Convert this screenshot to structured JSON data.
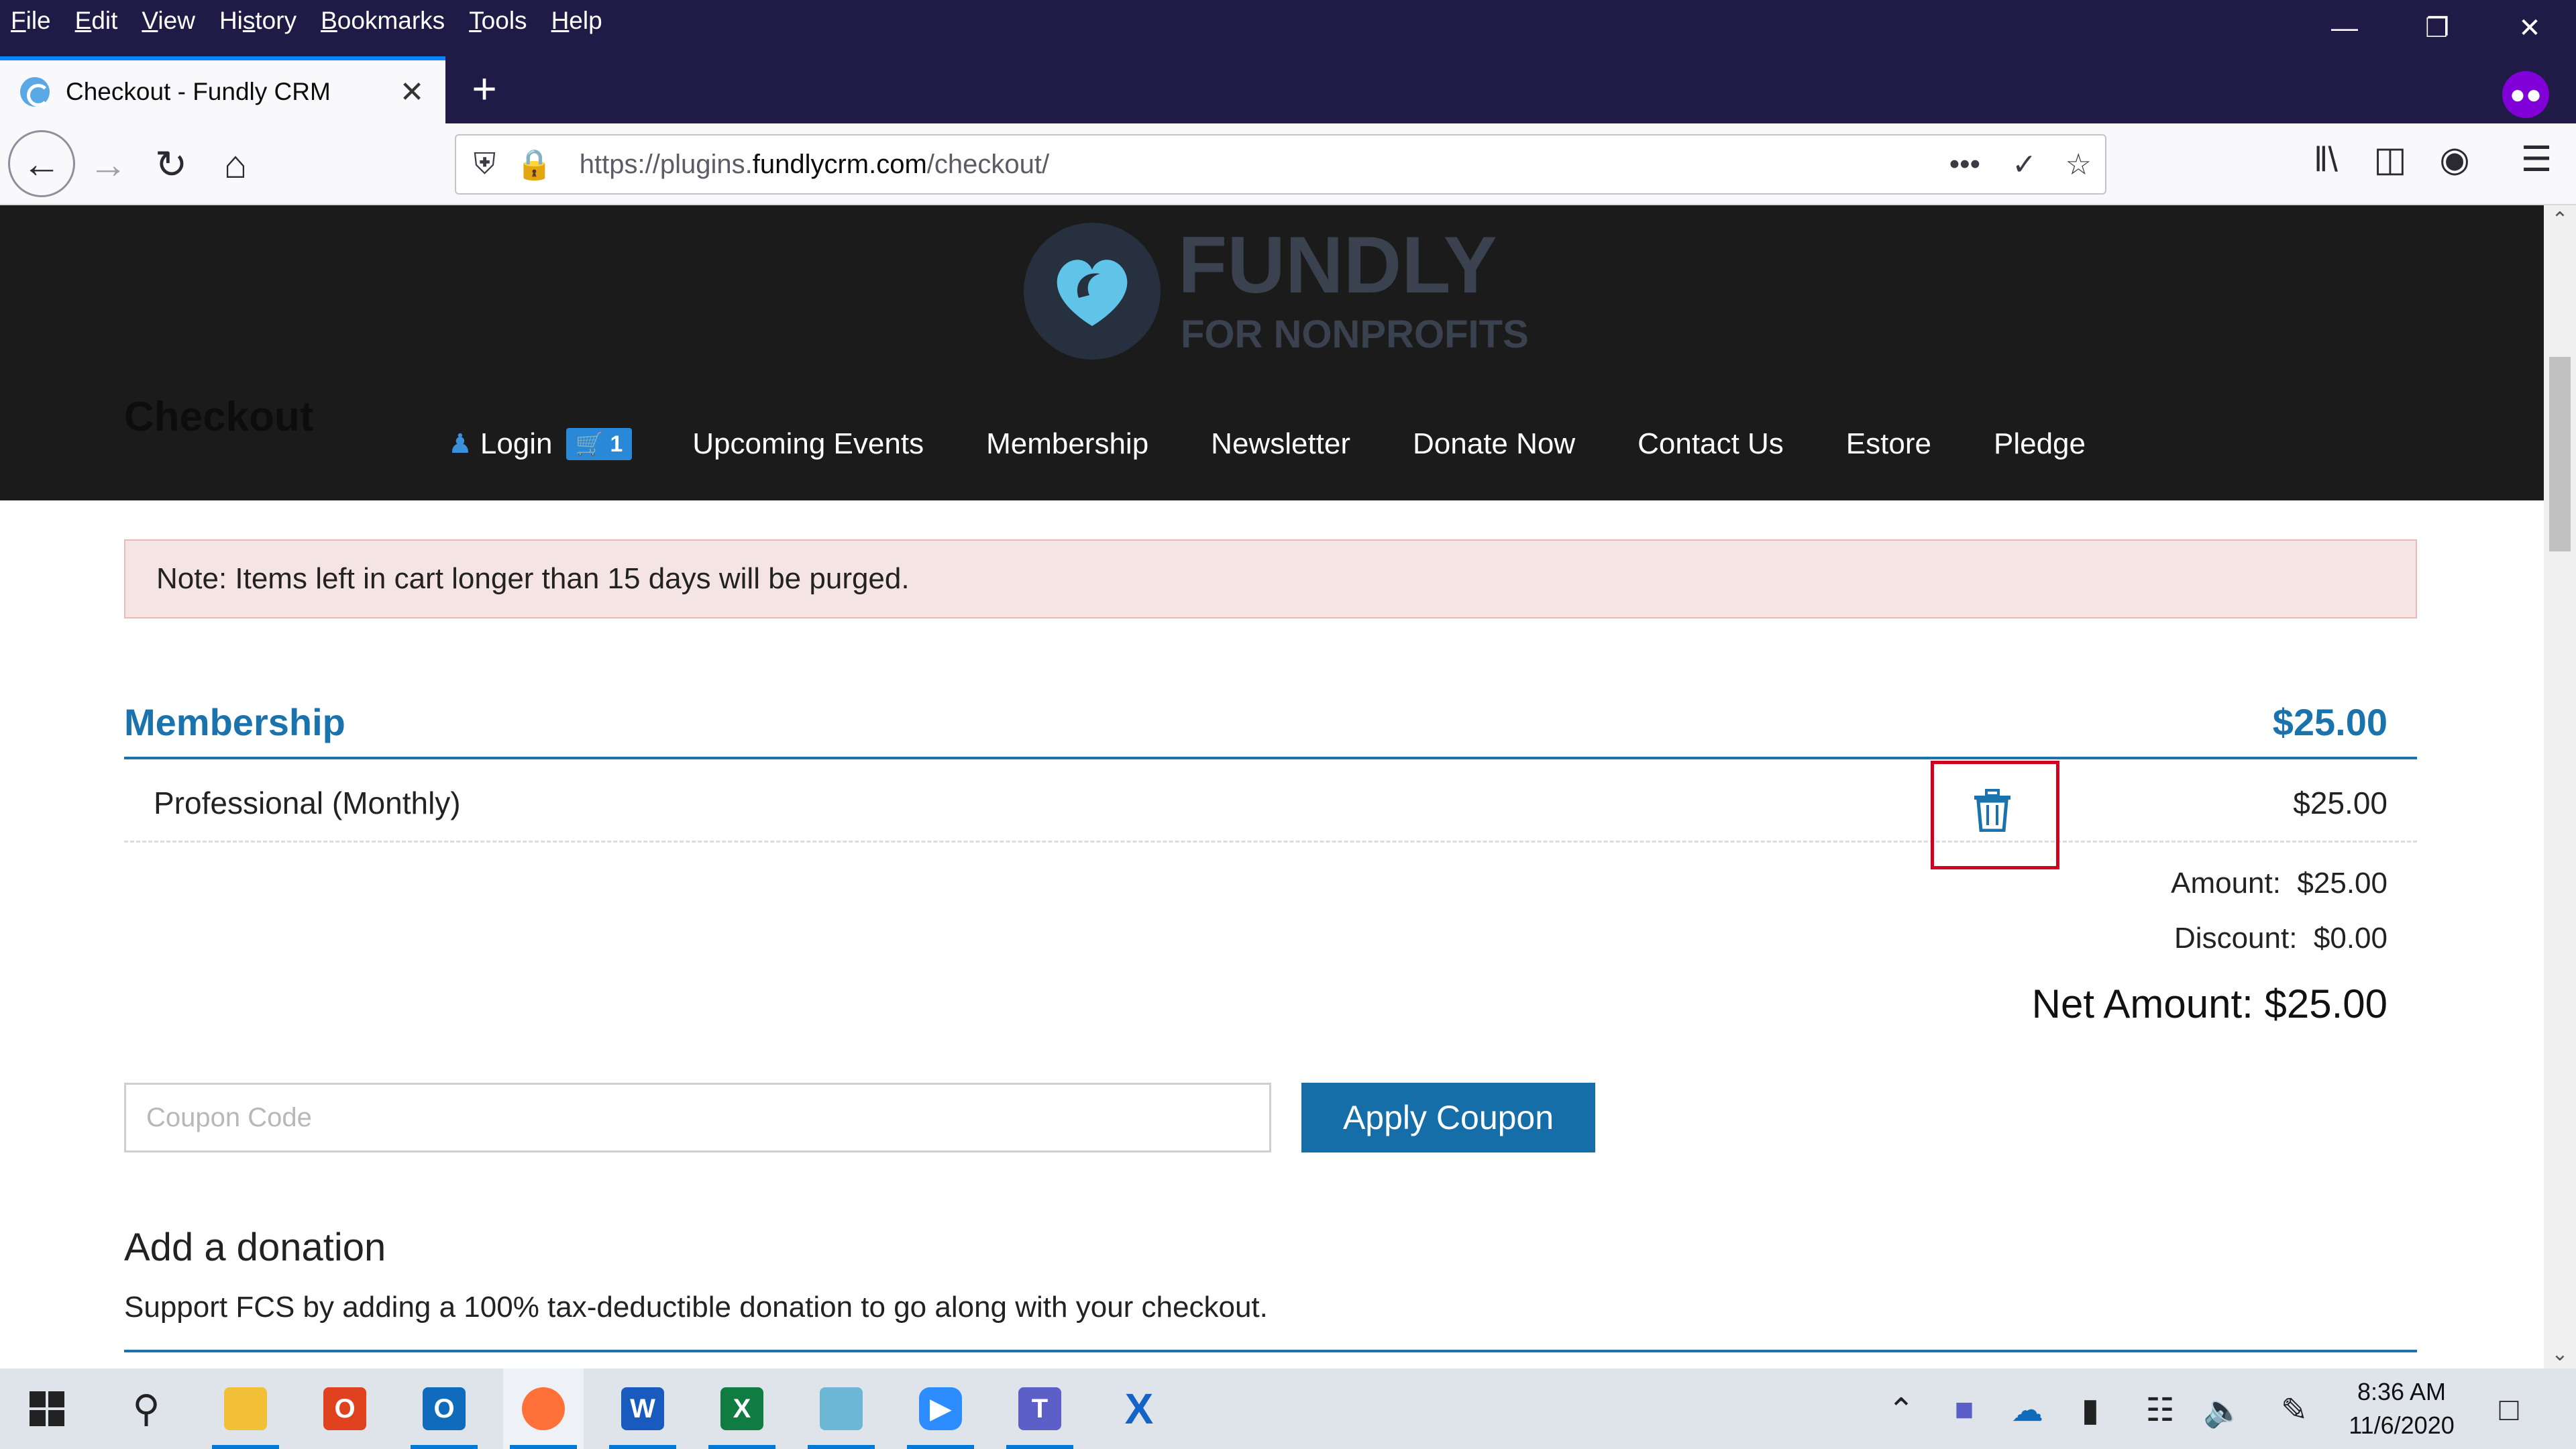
{
  "browser": {
    "menu": [
      "File",
      "Edit",
      "View",
      "History",
      "Bookmarks",
      "Tools",
      "Help"
    ],
    "tab_title": "Checkout - Fundly CRM",
    "url_prefix": "https://plugins.",
    "url_domain": "fundlycrm.com",
    "url_path": "/checkout/"
  },
  "site": {
    "logo_main": "FUNDLY",
    "logo_sub": "FOR NONPROFITS",
    "heading": "Checkout",
    "nav": {
      "login": "Login",
      "cart_count": "1",
      "items": [
        "Upcoming Events",
        "Membership",
        "Newsletter",
        "Donate Now",
        "Contact Us",
        "Estore",
        "Pledge"
      ]
    }
  },
  "notice": "Note: Items left in cart longer than 15 days will be purged.",
  "membership": {
    "title": "Membership",
    "total": "$25.00",
    "item_name": "Professional (Monthly)",
    "item_price": "$25.00"
  },
  "summary": {
    "amount_label": "Amount:",
    "amount_value": "$25.00",
    "discount_label": "Discount:",
    "discount_value": "$0.00",
    "net_label": "Net Amount:",
    "net_value": "$25.00"
  },
  "coupon": {
    "placeholder": "Coupon Code",
    "button": "Apply Coupon"
  },
  "donation": {
    "title": "Add a donation",
    "text": "Support FCS by adding a 100% tax-deductible donation to go along with your checkout."
  },
  "taskbar": {
    "time": "8:36 AM",
    "date": "11/6/2020"
  },
  "colors": {
    "accent": "#1a73ad",
    "highlight_box": "#d1001f",
    "header_bg": "#1b1b1b",
    "titlebar_bg": "#1f1b46"
  }
}
